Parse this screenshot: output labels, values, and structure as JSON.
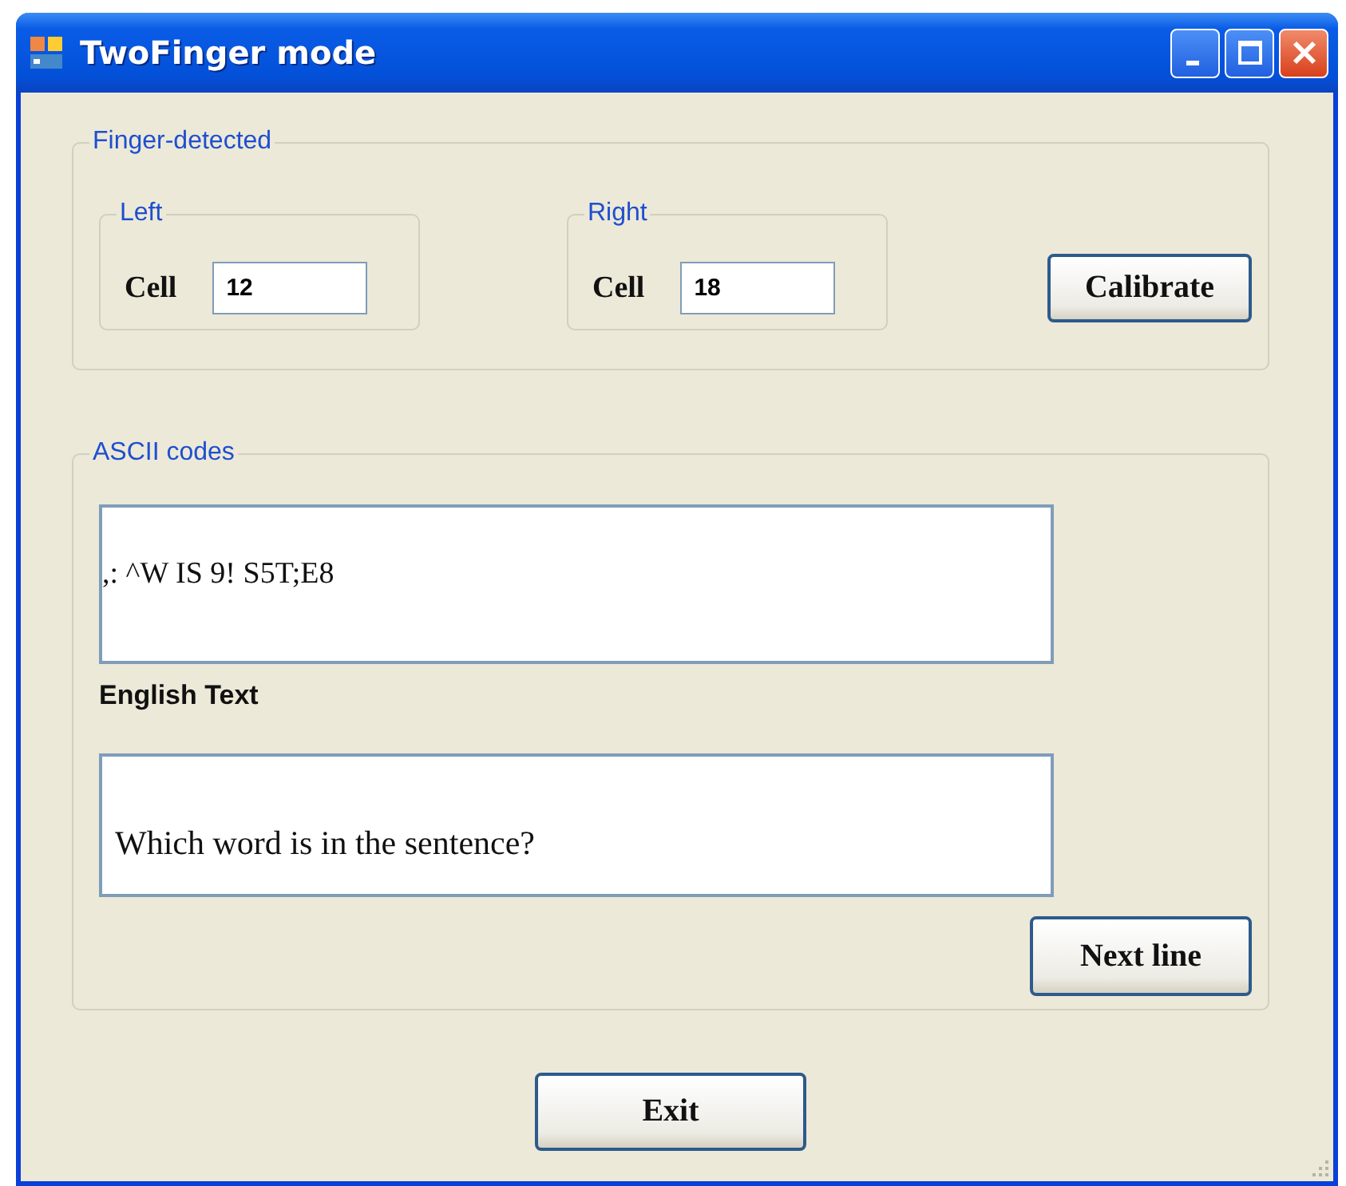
{
  "window": {
    "title": "TwoFinger mode"
  },
  "finger_detected": {
    "legend": "Finger-detected",
    "groups": [
      {
        "legend": "Left",
        "label": "Cell",
        "value": "12"
      },
      {
        "legend": "Right",
        "label": "Cell",
        "value": "18"
      }
    ],
    "button": "Calibrate"
  },
  "ascii_codes": {
    "legend": "ASCII codes",
    "codes_value": ",: ^W IS 9! S5T;E8",
    "english_label": "English Text",
    "english_value": "Which word is in the sentence?",
    "button": "Next line"
  },
  "buttons": [
    "Exit"
  ]
}
